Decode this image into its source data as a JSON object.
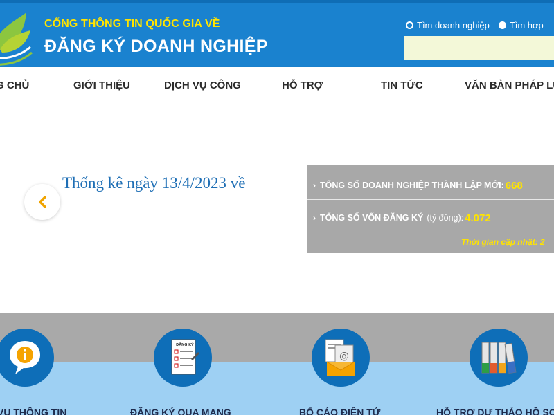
{
  "header": {
    "subtitle": "CỔNG THÔNG TIN QUỐC GIA VỀ",
    "title": "ĐĂNG KÝ DOANH NGHIỆP",
    "search_options": [
      "Tìm doanh nghiệp",
      "Tìm hợp"
    ],
    "search_value": ""
  },
  "nav": {
    "items": [
      "G CHỦ",
      "GIỚI THIỆU",
      "DỊCH VỤ CÔNG",
      "HỖ TRỢ",
      "TIN TỨC",
      "VĂN BẢN PHÁP LU"
    ]
  },
  "stats": {
    "heading": "Thống kê ngày 13/4/2023 về",
    "new_enterprises_label": "TỔNG SỐ DOANH NGHIỆP THÀNH LẬP MỚI:",
    "new_enterprises_value": "668",
    "capital_label": "TỔNG SỐ VỐN ĐĂNG KÝ",
    "capital_unit": "(tỷ đồng):",
    "capital_value": "4.072",
    "update_label": "Thời gian cập nhật: 2"
  },
  "services": [
    {
      "label": "VỤ THÔNG TIN",
      "icon": "info-chat-icon"
    },
    {
      "label": "ĐĂNG KÝ QUA MẠNG",
      "icon": "registration-form-icon"
    },
    {
      "label": "BỐ CÁO ĐIỆN TỬ",
      "icon": "email-document-icon"
    },
    {
      "label": "HỖ TRỢ DỰ THẢO HỒ SƠ",
      "icon": "binders-icon"
    }
  ],
  "colors": {
    "header_bg": "#1a82cf",
    "accent_yellow": "#ffe400",
    "stats_bg": "#a8a8a8",
    "service_circle": "#0e6eb8",
    "services_band": "#9ed0f3"
  }
}
